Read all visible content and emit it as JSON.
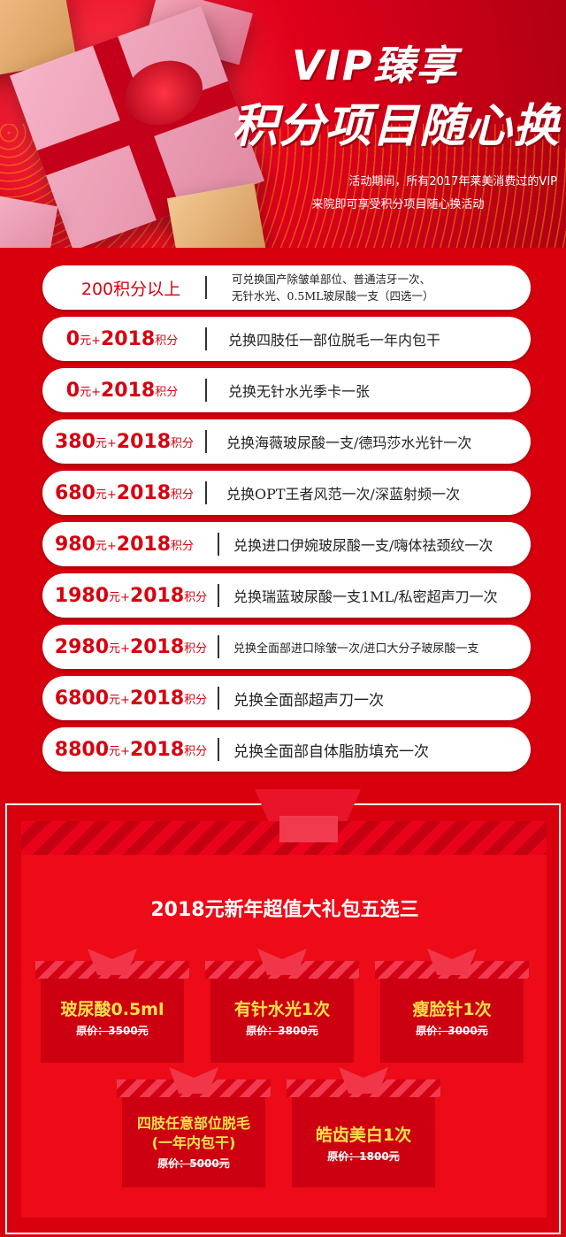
{
  "hero": {
    "title_line1": "VIP臻享",
    "title_line2": "积分项目随心换",
    "subtitle_line1": "活动期间，所有2017年莱美消费过的VIP",
    "subtitle_line2": "来院即可享受积分项目随心换活动"
  },
  "rows": [
    {
      "price_big": "200积分以上",
      "desc_line1": "可兑换国产除皱单部位、普通洁牙一次、",
      "desc_line2": "无针水光、0.5ML玻尿酸一支（四选一）"
    },
    {
      "price_big": "0",
      "unit_yuan": "元+",
      "price_points": "2018",
      "unit_points": "积分",
      "desc": "兑换四肢任一部位脱毛一年内包干"
    },
    {
      "price_big": "0",
      "unit_yuan": "元+",
      "price_points": "2018",
      "unit_points": "积分",
      "desc": "兑换无针水光季卡一张"
    },
    {
      "price_big": "380",
      "unit_yuan": "元+",
      "price_points": "2018",
      "unit_points": "积分",
      "desc": "兑换海薇玻尿酸一支/德玛莎水光针一次"
    },
    {
      "price_big": "680",
      "unit_yuan": "元+",
      "price_points": "2018",
      "unit_points": "积分",
      "desc": "兑换OPT王者风范一次/深蓝射频一次"
    },
    {
      "price_big": "980",
      "unit_yuan": "元+",
      "price_points": "2018",
      "unit_points": "积分",
      "desc": "兑换进口伊婉玻尿酸一支/嗨体祛颈纹一次"
    },
    {
      "price_big": "1980",
      "unit_yuan": "元+",
      "price_points": "2018",
      "unit_points": "积分",
      "desc": "兑换瑞蓝玻尿酸一支1ML/私密超声刀一次"
    },
    {
      "price_big": "2980",
      "unit_yuan": "元+",
      "price_points": "2018",
      "unit_points": "积分",
      "desc": "兑换全面部进口除皱一次/进口大分子玻尿酸一支"
    },
    {
      "price_big": "6800",
      "unit_yuan": "元+",
      "price_points": "2018",
      "unit_points": "积分",
      "desc": "兑换全面部超声刀一次"
    },
    {
      "price_big": "8800",
      "unit_yuan": "元+",
      "price_points": "2018",
      "unit_points": "积分",
      "desc": "兑换全面部自体脂肪填充一次"
    }
  ],
  "package": {
    "title": "2018元新年超值大礼包五选三",
    "gifts": [
      {
        "name": "玻尿酸0.5ml",
        "price": "原价：3500元"
      },
      {
        "name": "有针水光1次",
        "price": "原价：3800元"
      },
      {
        "name": "瘦脸针1次",
        "price": "原价：3000元"
      },
      {
        "name_line1": "四肢任意部位脱毛",
        "name_line2": "(一年内包干)",
        "price": "原价：5000元"
      },
      {
        "name": "皓齿美白1次",
        "price": "原价：1800元"
      }
    ]
  },
  "colors": {
    "primary_red": "#d9000e",
    "gold_text": "#ffe14a",
    "price_red": "#d7000f"
  }
}
